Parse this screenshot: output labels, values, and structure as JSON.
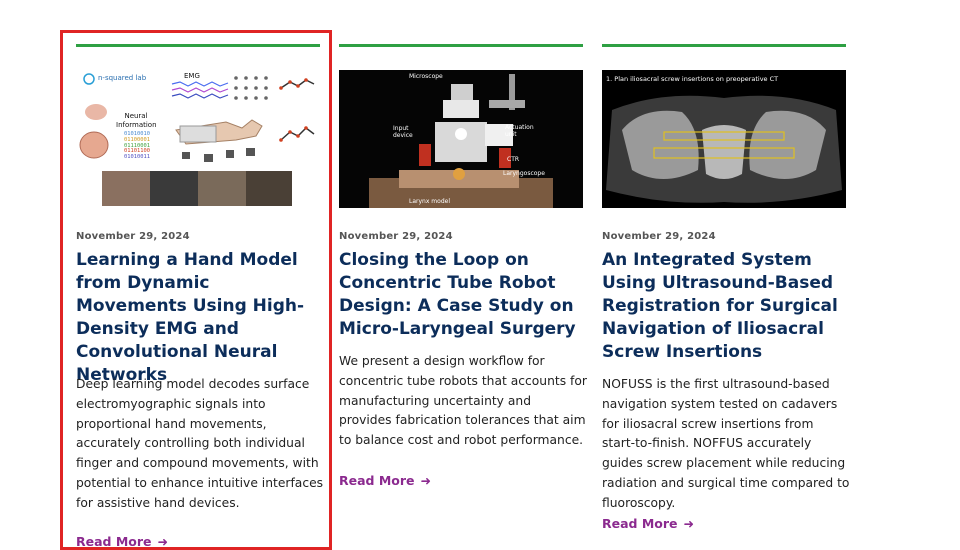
{
  "posts": [
    {
      "date": "November 29, 2024",
      "title": "Learning a Hand Model from Dynamic Movements Using High-Density EMG and Convolutional Neural Networks",
      "excerpt": "Deep learning model decodes surface electromyographic signals into proportional hand movements, accurately controlling both individual finger and compound movements, with potential to enhance intuitive interfaces for assistive hand devices.",
      "read_more": "Read More",
      "image": {
        "lab_label": "n-squared lab",
        "emg_label": "EMG",
        "neural_label": "Neural Information",
        "bits": [
          "01010010",
          "01100001",
          "01110001",
          "01101100",
          "01010011"
        ]
      }
    },
    {
      "date": "November 29, 2024",
      "title": "Closing the Loop on Concentric Tube Robot Design: A Case Study on Micro-Laryngeal Surgery",
      "excerpt": "We present a design workflow for concentric tube robots that accounts for manufacturing uncertainty and provides fabrication tolerances that aim to balance cost and robot performance.",
      "read_more": "Read More",
      "image": {
        "microscope": "Microscope",
        "input_device": "Input device",
        "actuation_unit": "Actuation unit",
        "ctr": "CTR",
        "laryngoscope": "Laryngoscope",
        "larynx_model": "Larynx model"
      }
    },
    {
      "date": "November 29, 2024",
      "title": "An Integrated System Using Ultrasound-Based Registration for Surgical Navigation of Iliosacral Screw Insertions",
      "excerpt": "NOFUSS is the first ultrasound-based navigation system tested on cadavers for iliosacral screw insertions from start-to-finish. NOFFUS accurately guides screw placement while reducing radiation and surgical time compared to fluoroscopy.",
      "read_more": "Read More",
      "image": {
        "caption": "1. Plan iliosacral screw insertions on preoperative CT"
      }
    }
  ],
  "colors": {
    "accent_bar": "#2ea043",
    "title": "#0c2d5a",
    "read_more": "#8b2a8f",
    "focus_ring": "#e02424"
  },
  "icons": {
    "read_more_arrow": "arrow-right-icon"
  }
}
